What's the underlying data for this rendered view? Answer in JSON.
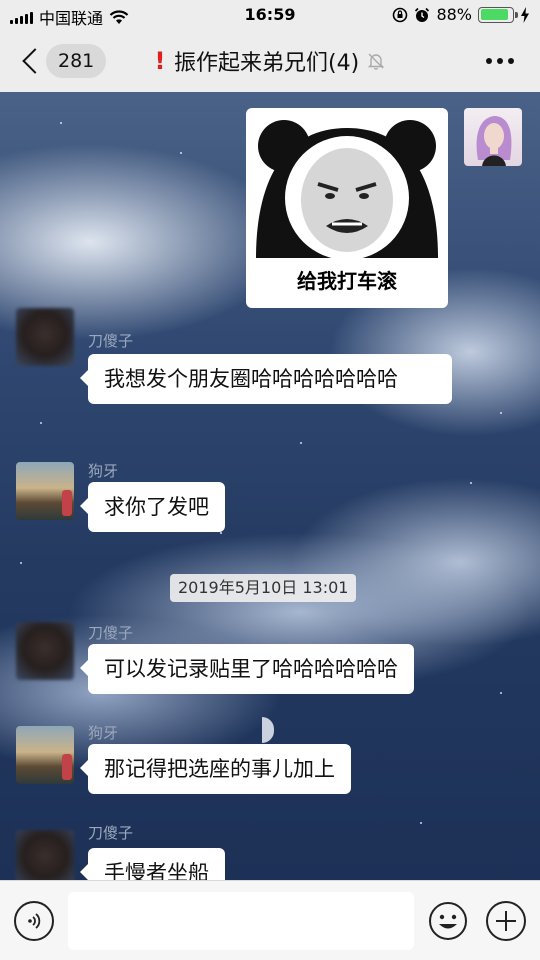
{
  "status_bar": {
    "carrier": "中国联通",
    "time": "16:59",
    "battery_percent": "88%",
    "battery_level": 0.88
  },
  "nav": {
    "unread_count": "281",
    "title": "振作起来弟兄们(4)",
    "muted": true
  },
  "sticker": {
    "caption": "给我打车滚"
  },
  "messages": [
    {
      "sender": "刀傻子",
      "text": "我想发个朋友圈哈哈哈哈哈哈哈"
    },
    {
      "sender": "狗牙",
      "text": "求你了发吧"
    },
    {
      "sender": "刀傻子",
      "text": "可以发记录贴里了哈哈哈哈哈哈"
    },
    {
      "sender": "狗牙",
      "text": "那记得把选座的事儿加上"
    },
    {
      "sender": "刀傻子",
      "text": "手慢者坐船"
    }
  ],
  "timestamp": "2019年5月10日 13:01",
  "input": {
    "placeholder": ""
  },
  "colors": {
    "accent_green": "#4cd964",
    "alert_red": "#e0201e",
    "sender_name": "#9aa8bd"
  },
  "icons": [
    "wifi-icon",
    "lock-rotation-icon",
    "alarm-icon",
    "charging-icon",
    "mute-bell-icon",
    "voice-icon",
    "emoji-icon",
    "plus-icon"
  ]
}
